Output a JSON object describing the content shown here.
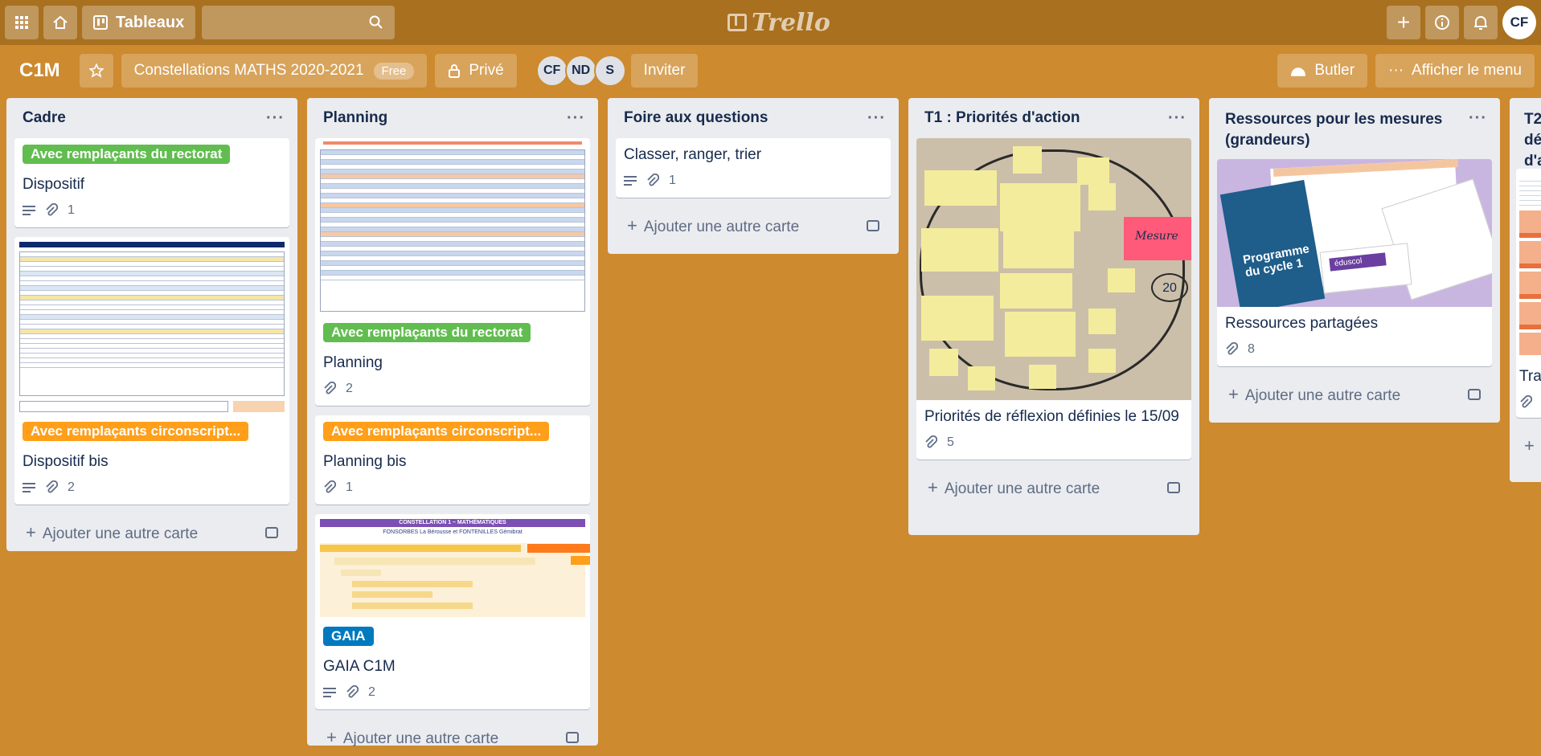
{
  "topbar": {
    "apps_icon": "grid-icon",
    "home_icon": "home-icon",
    "boards_label": "Tableaux",
    "search_icon": "search-icon",
    "logo_text": "Trello",
    "plus_icon": "plus-icon",
    "info_icon": "info-icon",
    "bell_icon": "bell-icon",
    "avatar": "CF"
  },
  "board": {
    "title": "C1M",
    "name": "Constellations MATHS 2020-2021",
    "plan_badge": "Free",
    "visibility": "Privé",
    "members": [
      "CF",
      "ND",
      "S"
    ],
    "invite_label": "Inviter",
    "butler_label": "Butler",
    "menu_label": "Afficher le menu"
  },
  "add_card_label": "Ajouter une autre carte",
  "lists": [
    {
      "title": "Cadre",
      "cards": [
        {
          "label": "Avec remplaçants du rectorat",
          "title": "Dispositif",
          "attachments": "1"
        },
        {
          "label": "Avec remplaçants circonscript...",
          "title": "Dispositif bis",
          "attachments": "2"
        }
      ]
    },
    {
      "title": "Planning",
      "cards": [
        {
          "label": "Avec remplaçants du rectorat",
          "title": "Planning",
          "attachments": "2"
        },
        {
          "label": "Avec remplaçants circonscript...",
          "title": "Planning bis",
          "attachments": "1"
        },
        {
          "label": "GAIA",
          "title": "GAIA C1M",
          "attachments": "2",
          "cover_heading": "CONSTELLATION 1 – MATHÉMATIQUES",
          "cover_sub": "FONSORBES La Bérousse et FONTENILLES Gémibrat"
        }
      ]
    },
    {
      "title": "Foire aux questions",
      "cards": [
        {
          "title": "Classer, ranger, trier",
          "attachments": "1"
        }
      ]
    },
    {
      "title": "T1 : Priorités d'action",
      "cards": [
        {
          "title": "Priorités de réflexion définies le 15/09",
          "attachments": "5",
          "cover_note": "Mesure",
          "cover_number": "20"
        }
      ]
    },
    {
      "title": "Ressources pour les mesures (grandeurs)",
      "cards": [
        {
          "title": "Ressources partagées",
          "attachments": "8",
          "cover_text1": "Programme du cycle 1",
          "cover_text2": "éduscol"
        }
      ]
    },
    {
      "title": "T2 dé d'a",
      "cards": [
        {
          "title": "Tra"
        }
      ]
    }
  ],
  "colors": {
    "board_bg": "#cd8a2e",
    "label_green": "#61bd4f",
    "label_orange": "#ff9f1a",
    "label_blue": "#0079bf"
  }
}
